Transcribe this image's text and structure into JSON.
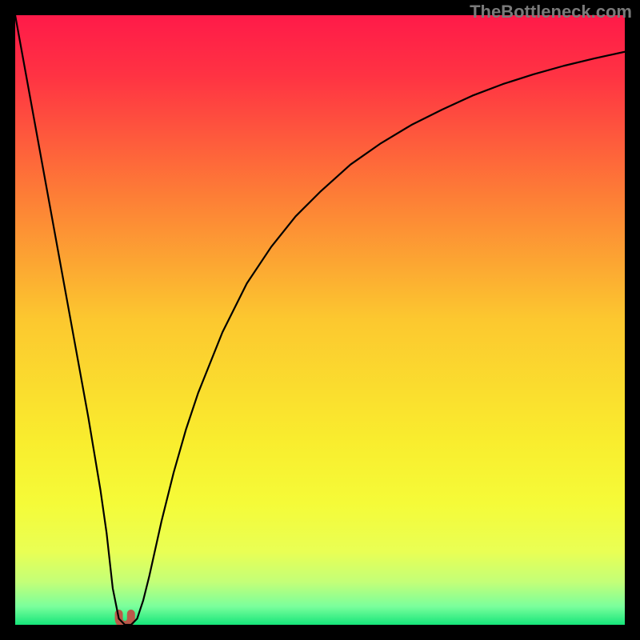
{
  "watermark": "TheBottleneck.com",
  "chart_data": {
    "type": "line",
    "title": "",
    "xlabel": "",
    "ylabel": "",
    "xlim": [
      0,
      100
    ],
    "ylim": [
      0,
      100
    ],
    "background_gradient": {
      "stops": [
        {
          "offset": 0.0,
          "color": "#ff1a49"
        },
        {
          "offset": 0.1,
          "color": "#ff3343"
        },
        {
          "offset": 0.3,
          "color": "#fd7f36"
        },
        {
          "offset": 0.5,
          "color": "#fcc82f"
        },
        {
          "offset": 0.7,
          "color": "#f9ed2e"
        },
        {
          "offset": 0.8,
          "color": "#f5fb38"
        },
        {
          "offset": 0.88,
          "color": "#e9ff54"
        },
        {
          "offset": 0.93,
          "color": "#c3ff78"
        },
        {
          "offset": 0.97,
          "color": "#7aff9c"
        },
        {
          "offset": 1.0,
          "color": "#16e57a"
        }
      ]
    },
    "series": [
      {
        "name": "bottleneck-curve",
        "color": "#000000",
        "stroke_width": 2.2,
        "x": [
          0,
          2,
          4,
          6,
          8,
          10,
          12,
          14,
          15,
          16,
          17,
          18,
          19,
          20,
          21,
          22,
          24,
          26,
          28,
          30,
          34,
          38,
          42,
          46,
          50,
          55,
          60,
          65,
          70,
          75,
          80,
          85,
          90,
          95,
          100
        ],
        "y": [
          100,
          89,
          78,
          67,
          56,
          45,
          34,
          22,
          15,
          6,
          1,
          0,
          0,
          1,
          4,
          8,
          17,
          25,
          32,
          38,
          48,
          56,
          62,
          67,
          71,
          75.5,
          79,
          82,
          84.5,
          86.8,
          88.7,
          90.3,
          91.7,
          92.9,
          94
        ]
      }
    ],
    "minimum_marker": {
      "x_range": [
        17,
        19
      ],
      "y": 0,
      "color": "#bb5a4a",
      "stroke_width": 10
    }
  }
}
